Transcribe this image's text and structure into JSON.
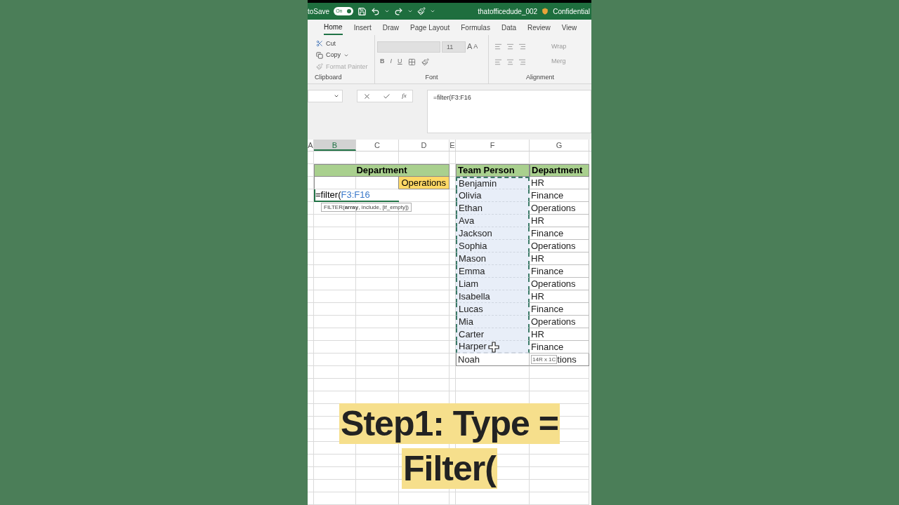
{
  "title_bar": {
    "autosave_label": "toSave",
    "autosave_toggle": "On",
    "autosave_on": true,
    "file_name": "thatofficedude_002",
    "sensitivity": "Confidential"
  },
  "ribbon_tabs": [
    {
      "label": "Home",
      "selected": true
    },
    {
      "label": "Insert",
      "selected": false
    },
    {
      "label": "Draw",
      "selected": false
    },
    {
      "label": "Page Layout",
      "selected": false
    },
    {
      "label": "Formulas",
      "selected": false
    },
    {
      "label": "Data",
      "selected": false
    },
    {
      "label": "Review",
      "selected": false
    },
    {
      "label": "View",
      "selected": false
    }
  ],
  "ribbon": {
    "clipboard": {
      "cut": "Cut",
      "copy": "Copy",
      "format_painter": "Format Painter",
      "label": "Clipboard"
    },
    "font": {
      "size": "11",
      "grow": "A",
      "shrink": "A",
      "bold": "B",
      "italic": "I",
      "underline": "U",
      "label": "Font"
    },
    "alignment": {
      "wrap": "Wrap",
      "merge": "Merg",
      "label": "Alignment"
    }
  },
  "formula_bar": {
    "function_button": "fx",
    "value": "=filter(F3:F16"
  },
  "column_headers": [
    {
      "label": "A",
      "selected": false
    },
    {
      "label": "B",
      "selected": true
    },
    {
      "label": "C",
      "selected": false
    },
    {
      "label": "D",
      "selected": false
    },
    {
      "label": "E",
      "selected": false
    },
    {
      "label": "F",
      "selected": false
    },
    {
      "label": "G",
      "selected": false
    }
  ],
  "left_table": {
    "header": "Department",
    "criteria": "Operations",
    "editor_function": "=filter(",
    "editor_range": "F3:F16",
    "tooltip": "FILTER(**array**, include, [if_empty])"
  },
  "right_table": {
    "headers": [
      "Team Person",
      "Department"
    ],
    "rows": [
      {
        "name": "Benjamin",
        "department": "HR",
        "in_range": true
      },
      {
        "name": "Olivia",
        "department": "Finance",
        "in_range": true
      },
      {
        "name": "Ethan",
        "department": "Operations",
        "in_range": true
      },
      {
        "name": "Ava",
        "department": "HR",
        "in_range": true
      },
      {
        "name": "Jackson",
        "department": "Finance",
        "in_range": true
      },
      {
        "name": "Sophia",
        "department": "Operations",
        "in_range": true
      },
      {
        "name": "Mason",
        "department": "HR",
        "in_range": true
      },
      {
        "name": "Emma",
        "department": "Finance",
        "in_range": true
      },
      {
        "name": "Liam",
        "department": "Operations",
        "in_range": true
      },
      {
        "name": "Isabella",
        "department": "HR",
        "in_range": true
      },
      {
        "name": "Lucas",
        "department": "Finance",
        "in_range": true
      },
      {
        "name": "Mia",
        "department": "Operations",
        "in_range": true
      },
      {
        "name": "Carter",
        "department": "HR",
        "in_range": true
      },
      {
        "name": "Harper",
        "department": "Finance",
        "in_range": true
      },
      {
        "name": "Noah",
        "department": "tions",
        "in_range": false
      }
    ],
    "size_tip": "14R x 1C"
  },
  "caption": [
    "Step1: Type =",
    "Filter("
  ]
}
